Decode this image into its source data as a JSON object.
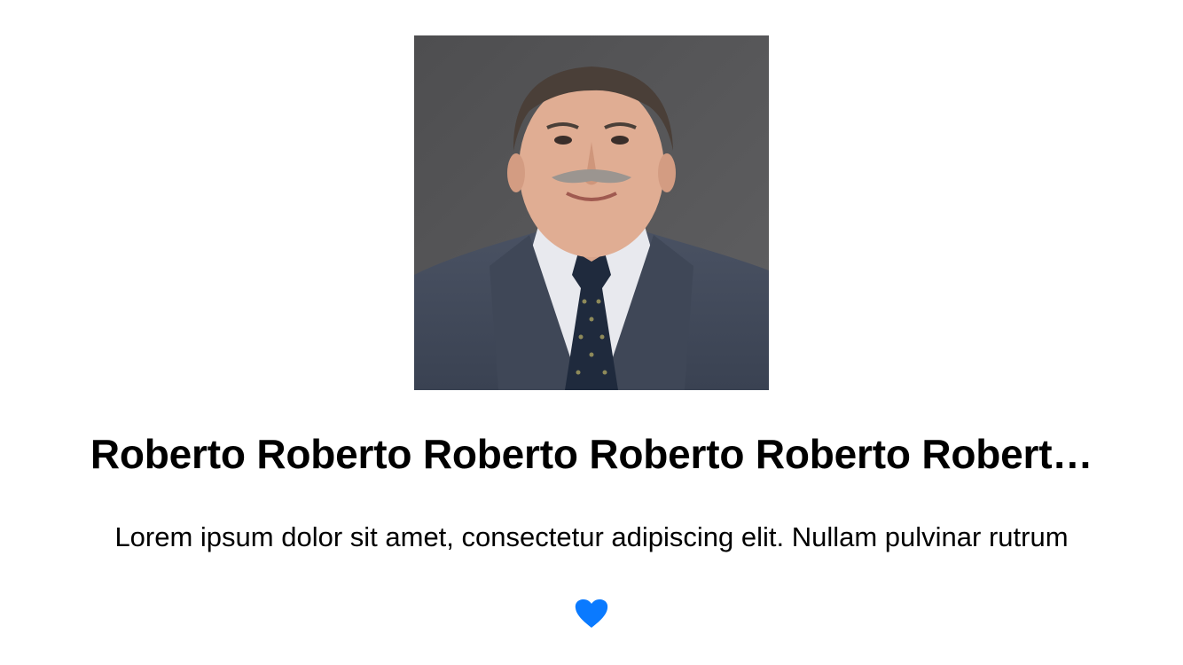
{
  "profile": {
    "name": "Roberto Roberto Roberto Roberto Roberto Robert…",
    "description": "Lorem ipsum dolor sit amet, consectetur adipiscing elit. Nullam pulvinar rutrum"
  },
  "like_button": {
    "icon": "heart-icon",
    "color": "#0A7AFF",
    "liked": true
  }
}
